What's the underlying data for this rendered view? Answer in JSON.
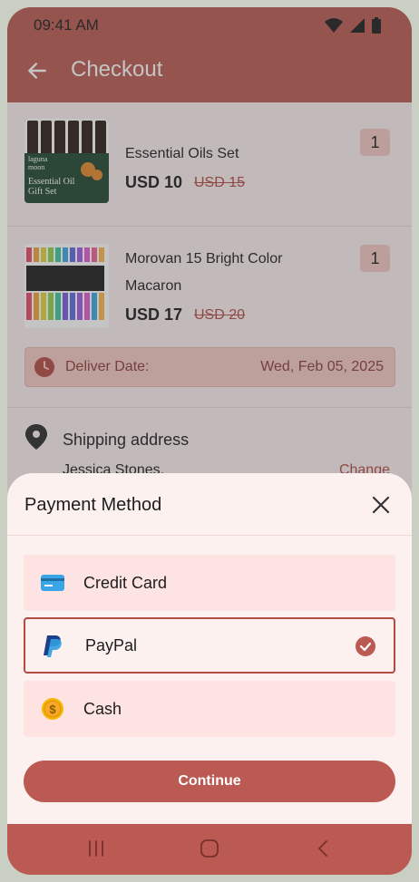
{
  "status_bar": {
    "time": "09:41 AM"
  },
  "app_bar": {
    "title": "Checkout"
  },
  "items": [
    {
      "name": "Essential Oils Set",
      "name_line2": "",
      "price": "USD 10",
      "old_price": "USD 15",
      "quantity": "1",
      "image_text_1": "laguna moon",
      "image_text_2": "Essential Oil Gift Set"
    },
    {
      "name": "Morovan 15 Bright Color",
      "name_line2": "Macaron",
      "price": "USD 17",
      "old_price": "USD 20",
      "quantity": "1"
    }
  ],
  "delivery": {
    "label": "Deliver Date:",
    "value": "Wed, Feb 05, 2025"
  },
  "shipping": {
    "title": "Shipping address",
    "name": "Jessica Stones,",
    "change_label": "Change"
  },
  "payment_sheet": {
    "title": "Payment Method",
    "options": [
      {
        "label": "Credit Card",
        "icon": "credit-card-icon",
        "selected": false
      },
      {
        "label": "PayPal",
        "icon": "paypal-icon",
        "selected": true
      },
      {
        "label": "Cash",
        "icon": "coin-icon",
        "selected": false
      }
    ],
    "continue_label": "Continue"
  },
  "colors": {
    "primary": "#bb5a53",
    "accent_text": "#b34a43",
    "surface": "#fdf1f0",
    "option_bg": "#fde3e1"
  }
}
